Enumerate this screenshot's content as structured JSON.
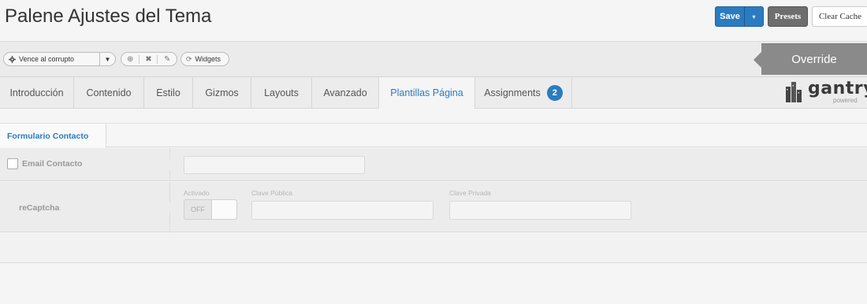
{
  "header": {
    "title": "Palene Ajustes del Tema",
    "save_label": "Save",
    "save_caret": "▾",
    "presets_label": "Presets",
    "clear_cache_label": "Clear Cache"
  },
  "toolbar": {
    "style_select_icon": "gear-icon",
    "style_select_value": "Vence al corrupto",
    "style_select_arrow": "▼",
    "tool_icons": [
      "copy-icon",
      "delete-icon",
      "edit-icon"
    ],
    "tool_glyphs": [
      "⊕",
      "✖",
      "✎"
    ],
    "widgets_icon_glyph": "⟳",
    "widgets_label": "Widgets",
    "override_label": "Override"
  },
  "tabs": [
    {
      "label": "Introducción"
    },
    {
      "label": "Contenido"
    },
    {
      "label": "Estilo"
    },
    {
      "label": "Gizmos"
    },
    {
      "label": "Layouts"
    },
    {
      "label": "Avanzado"
    },
    {
      "label": "Plantillas Página",
      "active": true
    },
    {
      "label": "Assignments",
      "badge": "2"
    }
  ],
  "logo": {
    "word": "gantry",
    "sub": "powered"
  },
  "subtabs": {
    "active_label": "Formulario Contacto"
  },
  "form": {
    "email_label": "Email Contacto",
    "email_value": "",
    "recaptcha_label": "reCaptcha",
    "activado_label": "Activado",
    "toggle_state": "OFF",
    "public_key_label": "Clave Pública",
    "public_key_value": "",
    "private_key_label": "Clave Privada",
    "private_key_value": ""
  },
  "colors": {
    "accent": "#2a7bc0",
    "presets_bg": "#6e6e6e",
    "override_bg": "#8a8a8a"
  }
}
